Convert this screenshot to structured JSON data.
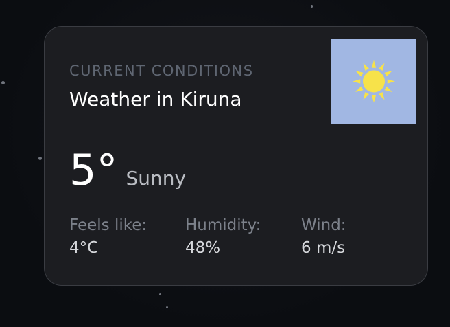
{
  "widget": {
    "eyebrow": "CURRENT CONDITIONS",
    "title": "Weather in Kiruna",
    "temperature": "5°",
    "condition": "Sunny",
    "icon": "sun-icon",
    "icon_bg": "#a1b7e3",
    "sun_color": "#f7e24a"
  },
  "stats": [
    {
      "label": "Feels like:",
      "value": "4°C"
    },
    {
      "label": "Humidity:",
      "value": "48%"
    },
    {
      "label": "Wind:",
      "value": "6 m/s"
    }
  ]
}
